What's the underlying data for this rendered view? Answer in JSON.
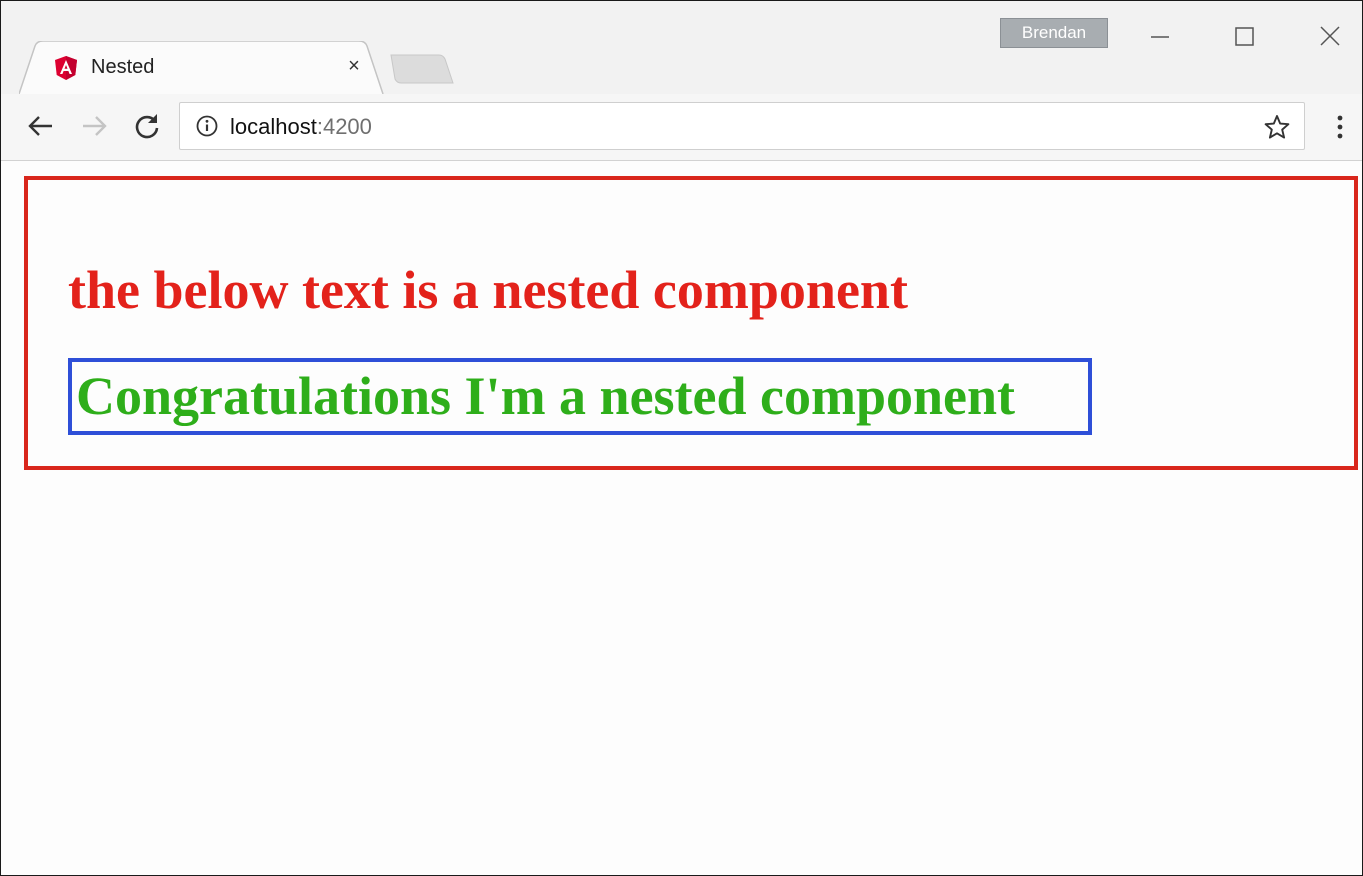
{
  "browser": {
    "profile_name": "Brendan",
    "tab": {
      "title": "Nested",
      "favicon": "angular-logo-icon",
      "close_glyph": "×"
    },
    "window_controls": [
      "minimize-icon",
      "maximize-icon",
      "close-icon"
    ],
    "toolbar": {
      "back_icon": "back-arrow-icon",
      "forward_icon": "forward-arrow-icon",
      "reload_icon": "reload-icon",
      "site_info_icon": "info-icon",
      "url_host": "localhost",
      "url_port": ":4200",
      "bookmark_icon": "star-icon",
      "menu_icon": "kebab-menu-icon"
    }
  },
  "page": {
    "parent_component": {
      "heading": "the below text is a nested component",
      "border_color": "#d9261c",
      "text_color": "#e3221b"
    },
    "child_component": {
      "text": "Congratulations I'm a nested component",
      "border_color": "#2e4fd8",
      "text_color": "#2eae1a"
    }
  }
}
